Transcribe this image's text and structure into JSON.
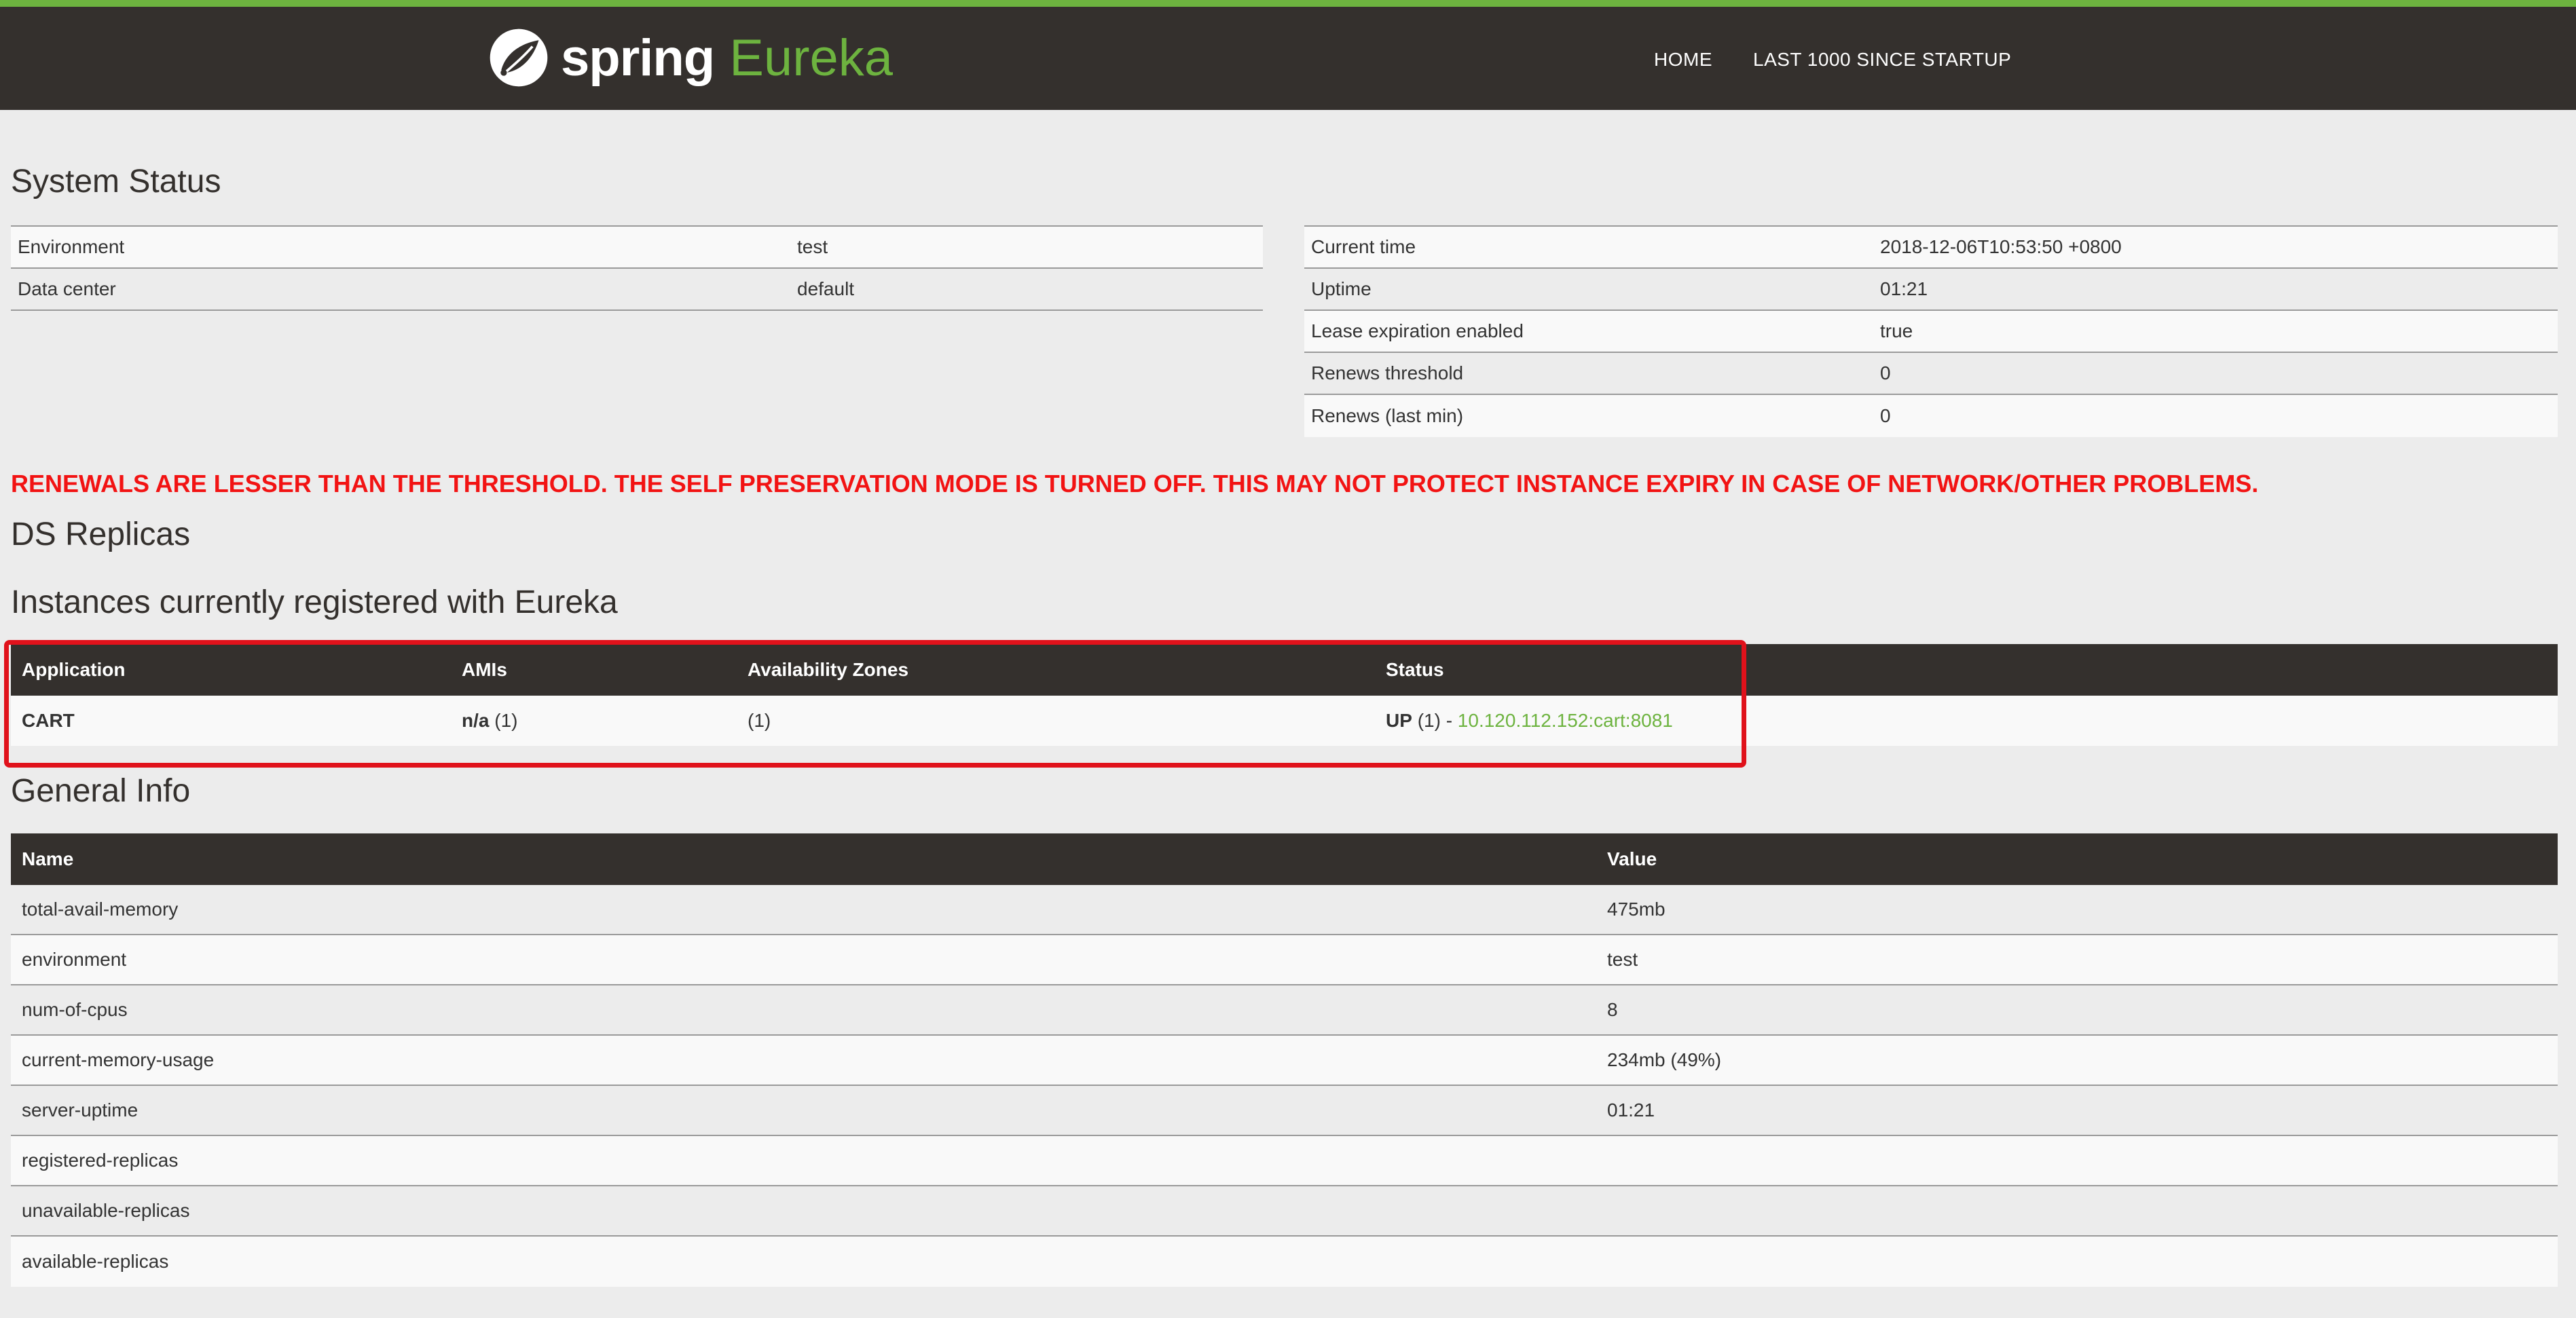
{
  "navbar": {
    "brand_spring": "spring",
    "brand_eureka": "Eureka",
    "links": [
      "HOME",
      "LAST 1000 SINCE STARTUP"
    ]
  },
  "system_status": {
    "title": "System Status",
    "left": [
      {
        "key": "Environment",
        "value": "test"
      },
      {
        "key": "Data center",
        "value": "default"
      }
    ],
    "right": [
      {
        "key": "Current time",
        "value": "2018-12-06T10:53:50 +0800"
      },
      {
        "key": "Uptime",
        "value": "01:21"
      },
      {
        "key": "Lease expiration enabled",
        "value": "true"
      },
      {
        "key": "Renews threshold",
        "value": "0"
      },
      {
        "key": "Renews (last min)",
        "value": "0"
      }
    ]
  },
  "warning": "RENEWALS ARE LESSER THAN THE THRESHOLD. THE SELF PRESERVATION MODE IS TURNED OFF. THIS MAY NOT PROTECT INSTANCE EXPIRY IN CASE OF NETWORK/OTHER PROBLEMS.",
  "ds_replicas": {
    "title": "DS Replicas"
  },
  "instances": {
    "title": "Instances currently registered with Eureka",
    "headers": [
      "Application",
      "AMIs",
      "Availability Zones",
      "Status"
    ],
    "rows": [
      {
        "application": "CART",
        "amis_bold": "n/a",
        "amis_count": "(1)",
        "zones": "(1)",
        "status_bold": "UP",
        "status_count": "(1) -",
        "status_link": "10.120.112.152:cart:8081"
      }
    ]
  },
  "general_info": {
    "title": "General Info",
    "headers": [
      "Name",
      "Value"
    ],
    "rows": [
      {
        "name": "total-avail-memory",
        "value": "475mb"
      },
      {
        "name": "environment",
        "value": "test"
      },
      {
        "name": "num-of-cpus",
        "value": "8"
      },
      {
        "name": "current-memory-usage",
        "value": "234mb (49%)"
      },
      {
        "name": "server-uptime",
        "value": "01:21"
      },
      {
        "name": "registered-replicas",
        "value": ""
      },
      {
        "name": "unavailable-replicas",
        "value": ""
      },
      {
        "name": "available-replicas",
        "value": ""
      }
    ]
  },
  "colors": {
    "nav_bg": "#34302d",
    "accent_green": "#6db33f",
    "warning_red": "#f21313",
    "highlight_red": "#e0121b"
  }
}
